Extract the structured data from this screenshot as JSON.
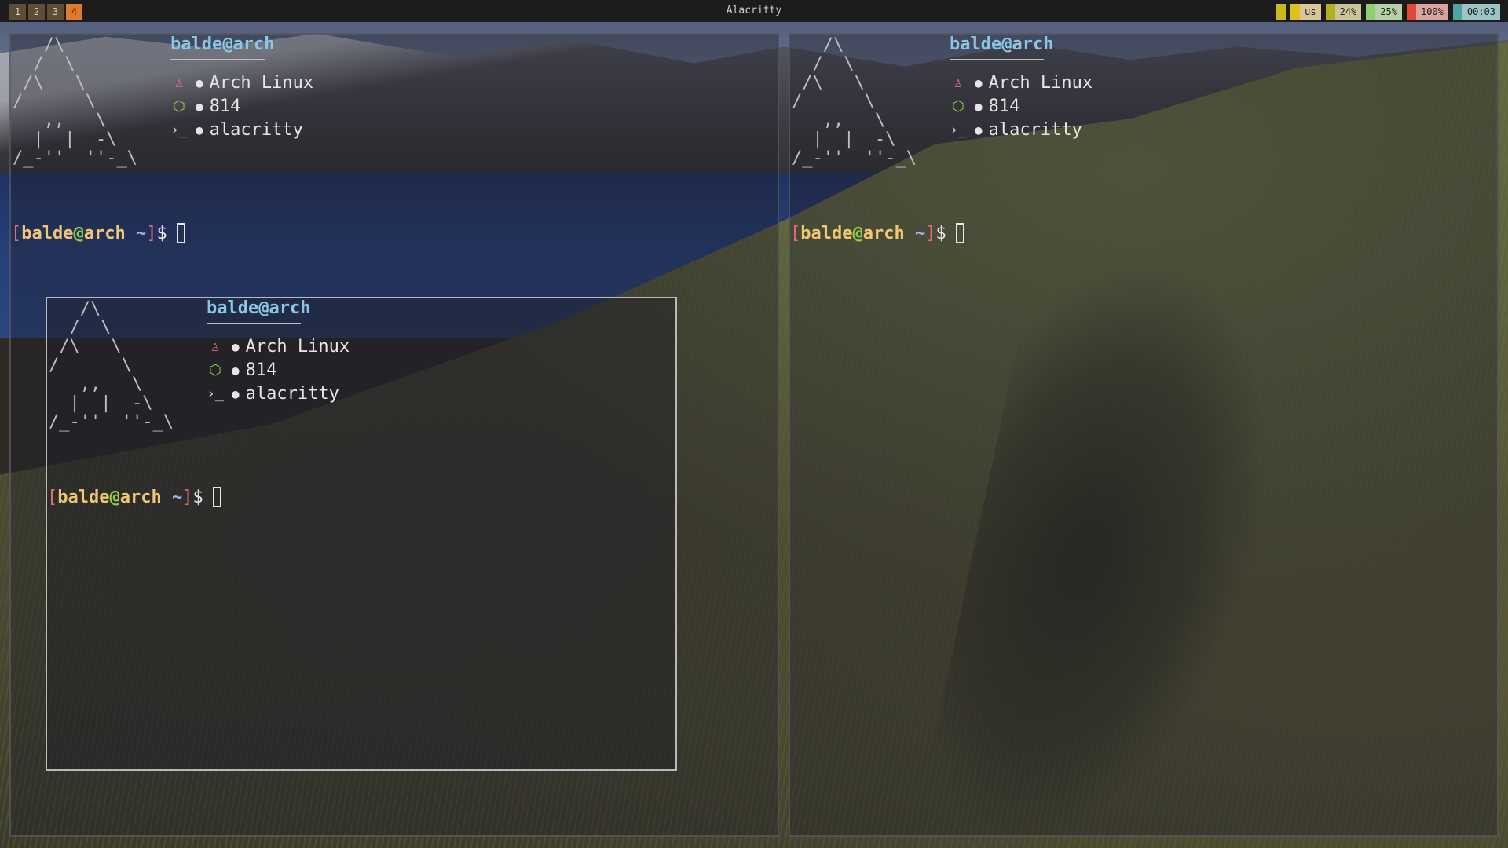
{
  "topbar": {
    "workspaces": [
      "1",
      "2",
      "3",
      "4"
    ],
    "active_workspace": "4",
    "window_title": "Alacritty",
    "status": {
      "kbd": "us",
      "cpu": "24%",
      "mem": "25%",
      "battery": "100%",
      "clock": "00:03"
    },
    "colors": {
      "kbd": "#e0c020",
      "cpu": "#b0b020",
      "mem": "#8fcf6f",
      "battery": "#e04838",
      "clock": "#4fa3a3"
    }
  },
  "fetch": {
    "user": "balde",
    "at": "@",
    "host": "arch",
    "os_icon": "arch-linux-icon",
    "os": "Arch Linux",
    "pkg_icon": "package-icon",
    "packages": "814",
    "shell_icon": "terminal-icon",
    "terminal": "alacritty",
    "bullet": "●",
    "logo": "   /\\\n  /  \\\n /\\   \\\n/      \\\n   ,,   \\\n  |  |  -\\\n/_-''  ''-_\\"
  },
  "prompt": {
    "open": "[",
    "user": "balde",
    "at": "@",
    "host": "arch",
    "path": " ~",
    "close": "]",
    "symbol": "$"
  }
}
